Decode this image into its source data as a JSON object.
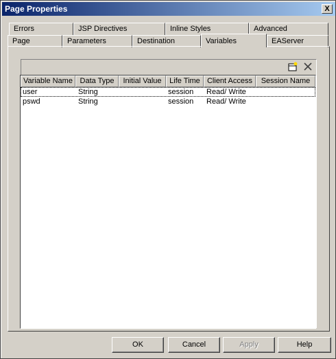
{
  "window": {
    "title": "Page Properties",
    "close_label": "X"
  },
  "tabs_row1": [
    "Errors",
    "JSP Directives",
    "Inline Styles",
    "Advanced"
  ],
  "tabs_row2": [
    "Page",
    "Parameters",
    "Destination",
    "Variables",
    "EAServer"
  ],
  "active_tab": "Variables",
  "toolbar": {
    "icons": [
      "new-row-icon",
      "delete-icon"
    ]
  },
  "grid": {
    "columns": [
      "Variable Name",
      "Data Type",
      "Initial  Value",
      "Life Time",
      "Client Access",
      "Session Name"
    ],
    "rows": [
      [
        "user",
        "String",
        "",
        "session",
        "Read/ Write",
        ""
      ],
      [
        "pswd",
        "String",
        "",
        "session",
        "Read/ Write",
        ""
      ]
    ]
  },
  "buttons": {
    "ok": "OK",
    "cancel": "Cancel",
    "apply": "Apply",
    "help": "Help"
  }
}
